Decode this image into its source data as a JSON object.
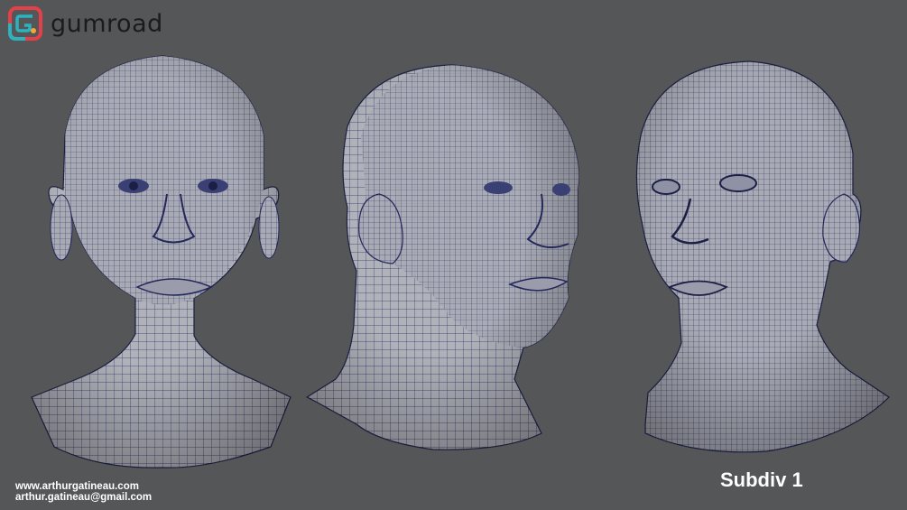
{
  "brand": {
    "name": "gumroad",
    "logo_icon": "gumroad-logo-icon"
  },
  "credits": {
    "website": "www.arthurgatineau.com",
    "email": "arthur.gatineau@gmail.com"
  },
  "label": "Subdiv 1",
  "views": [
    {
      "id": "front-view",
      "icon": "wireframe-head-front"
    },
    {
      "id": "three-quarter-view",
      "icon": "wireframe-head-three-quarter"
    },
    {
      "id": "angle-view",
      "icon": "wireframe-head-angle"
    }
  ],
  "colors": {
    "background": "#545657",
    "mesh_fill": "#aeb0b8",
    "wire": "#2a2f5e",
    "text": "#ffffff"
  }
}
